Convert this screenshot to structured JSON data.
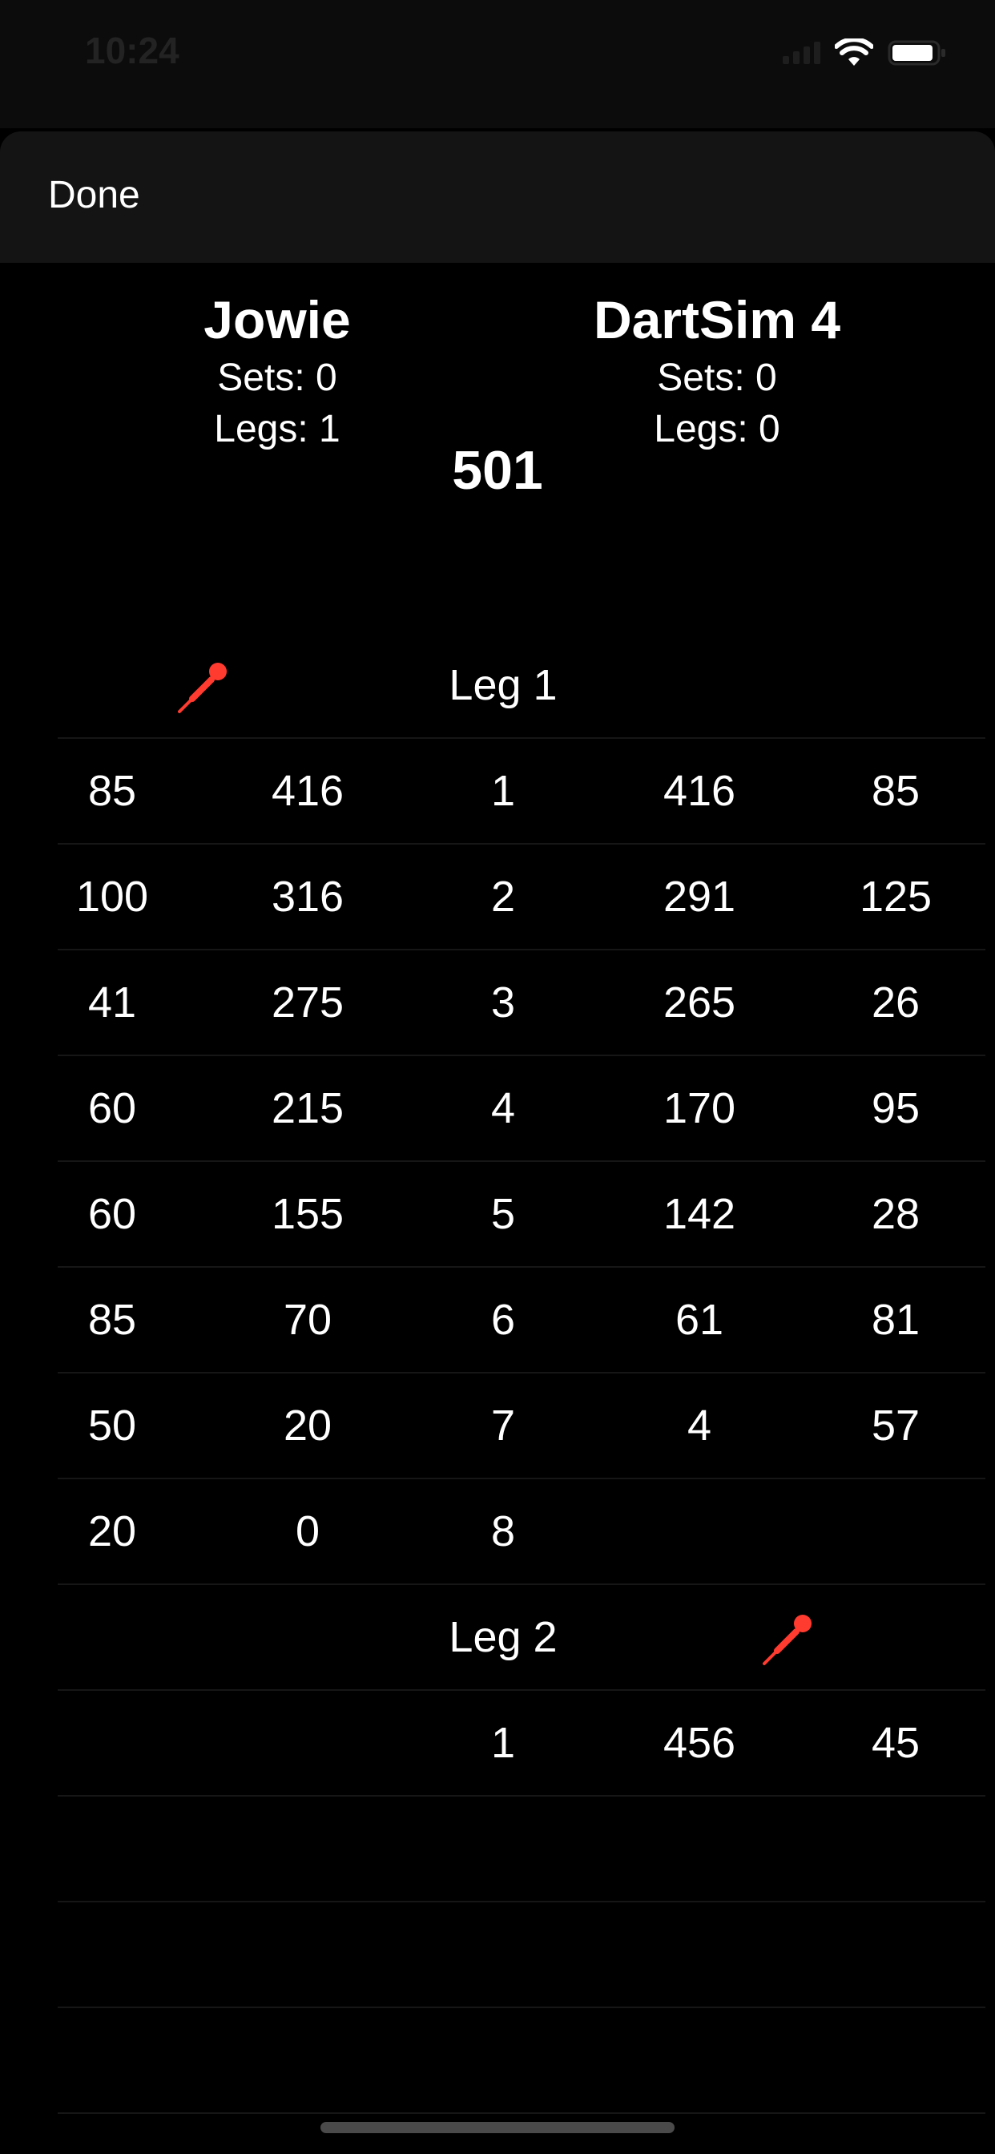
{
  "status": {
    "time": "10:24"
  },
  "nav": {
    "done_label": "Done"
  },
  "players": [
    {
      "name": "Jowie",
      "sets": "Sets: 0",
      "legs": "Legs: 1"
    },
    {
      "name": "DartSim 4",
      "sets": "Sets: 0",
      "legs": "Legs: 0"
    }
  ],
  "game_mode": "501",
  "legs": [
    {
      "label": "Leg 1",
      "starter": "left",
      "rows": [
        [
          "85",
          "416",
          "1",
          "416",
          "85"
        ],
        [
          "100",
          "316",
          "2",
          "291",
          "125"
        ],
        [
          "41",
          "275",
          "3",
          "265",
          "26"
        ],
        [
          "60",
          "215",
          "4",
          "170",
          "95"
        ],
        [
          "60",
          "155",
          "5",
          "142",
          "28"
        ],
        [
          "85",
          "70",
          "6",
          "61",
          "81"
        ],
        [
          "50",
          "20",
          "7",
          "4",
          "57"
        ],
        [
          "20",
          "0",
          "8",
          "",
          ""
        ]
      ]
    },
    {
      "label": "Leg 2",
      "starter": "right",
      "rows": [
        [
          "",
          "",
          "1",
          "456",
          "45"
        ]
      ]
    }
  ],
  "colors": {
    "dart": "#ff3b30",
    "divider": "#161616",
    "navbar": "#141414"
  },
  "icons": {
    "dart": "dart-icon",
    "wifi": "wifi-icon",
    "battery": "battery-icon",
    "signal": "signal-icon"
  }
}
